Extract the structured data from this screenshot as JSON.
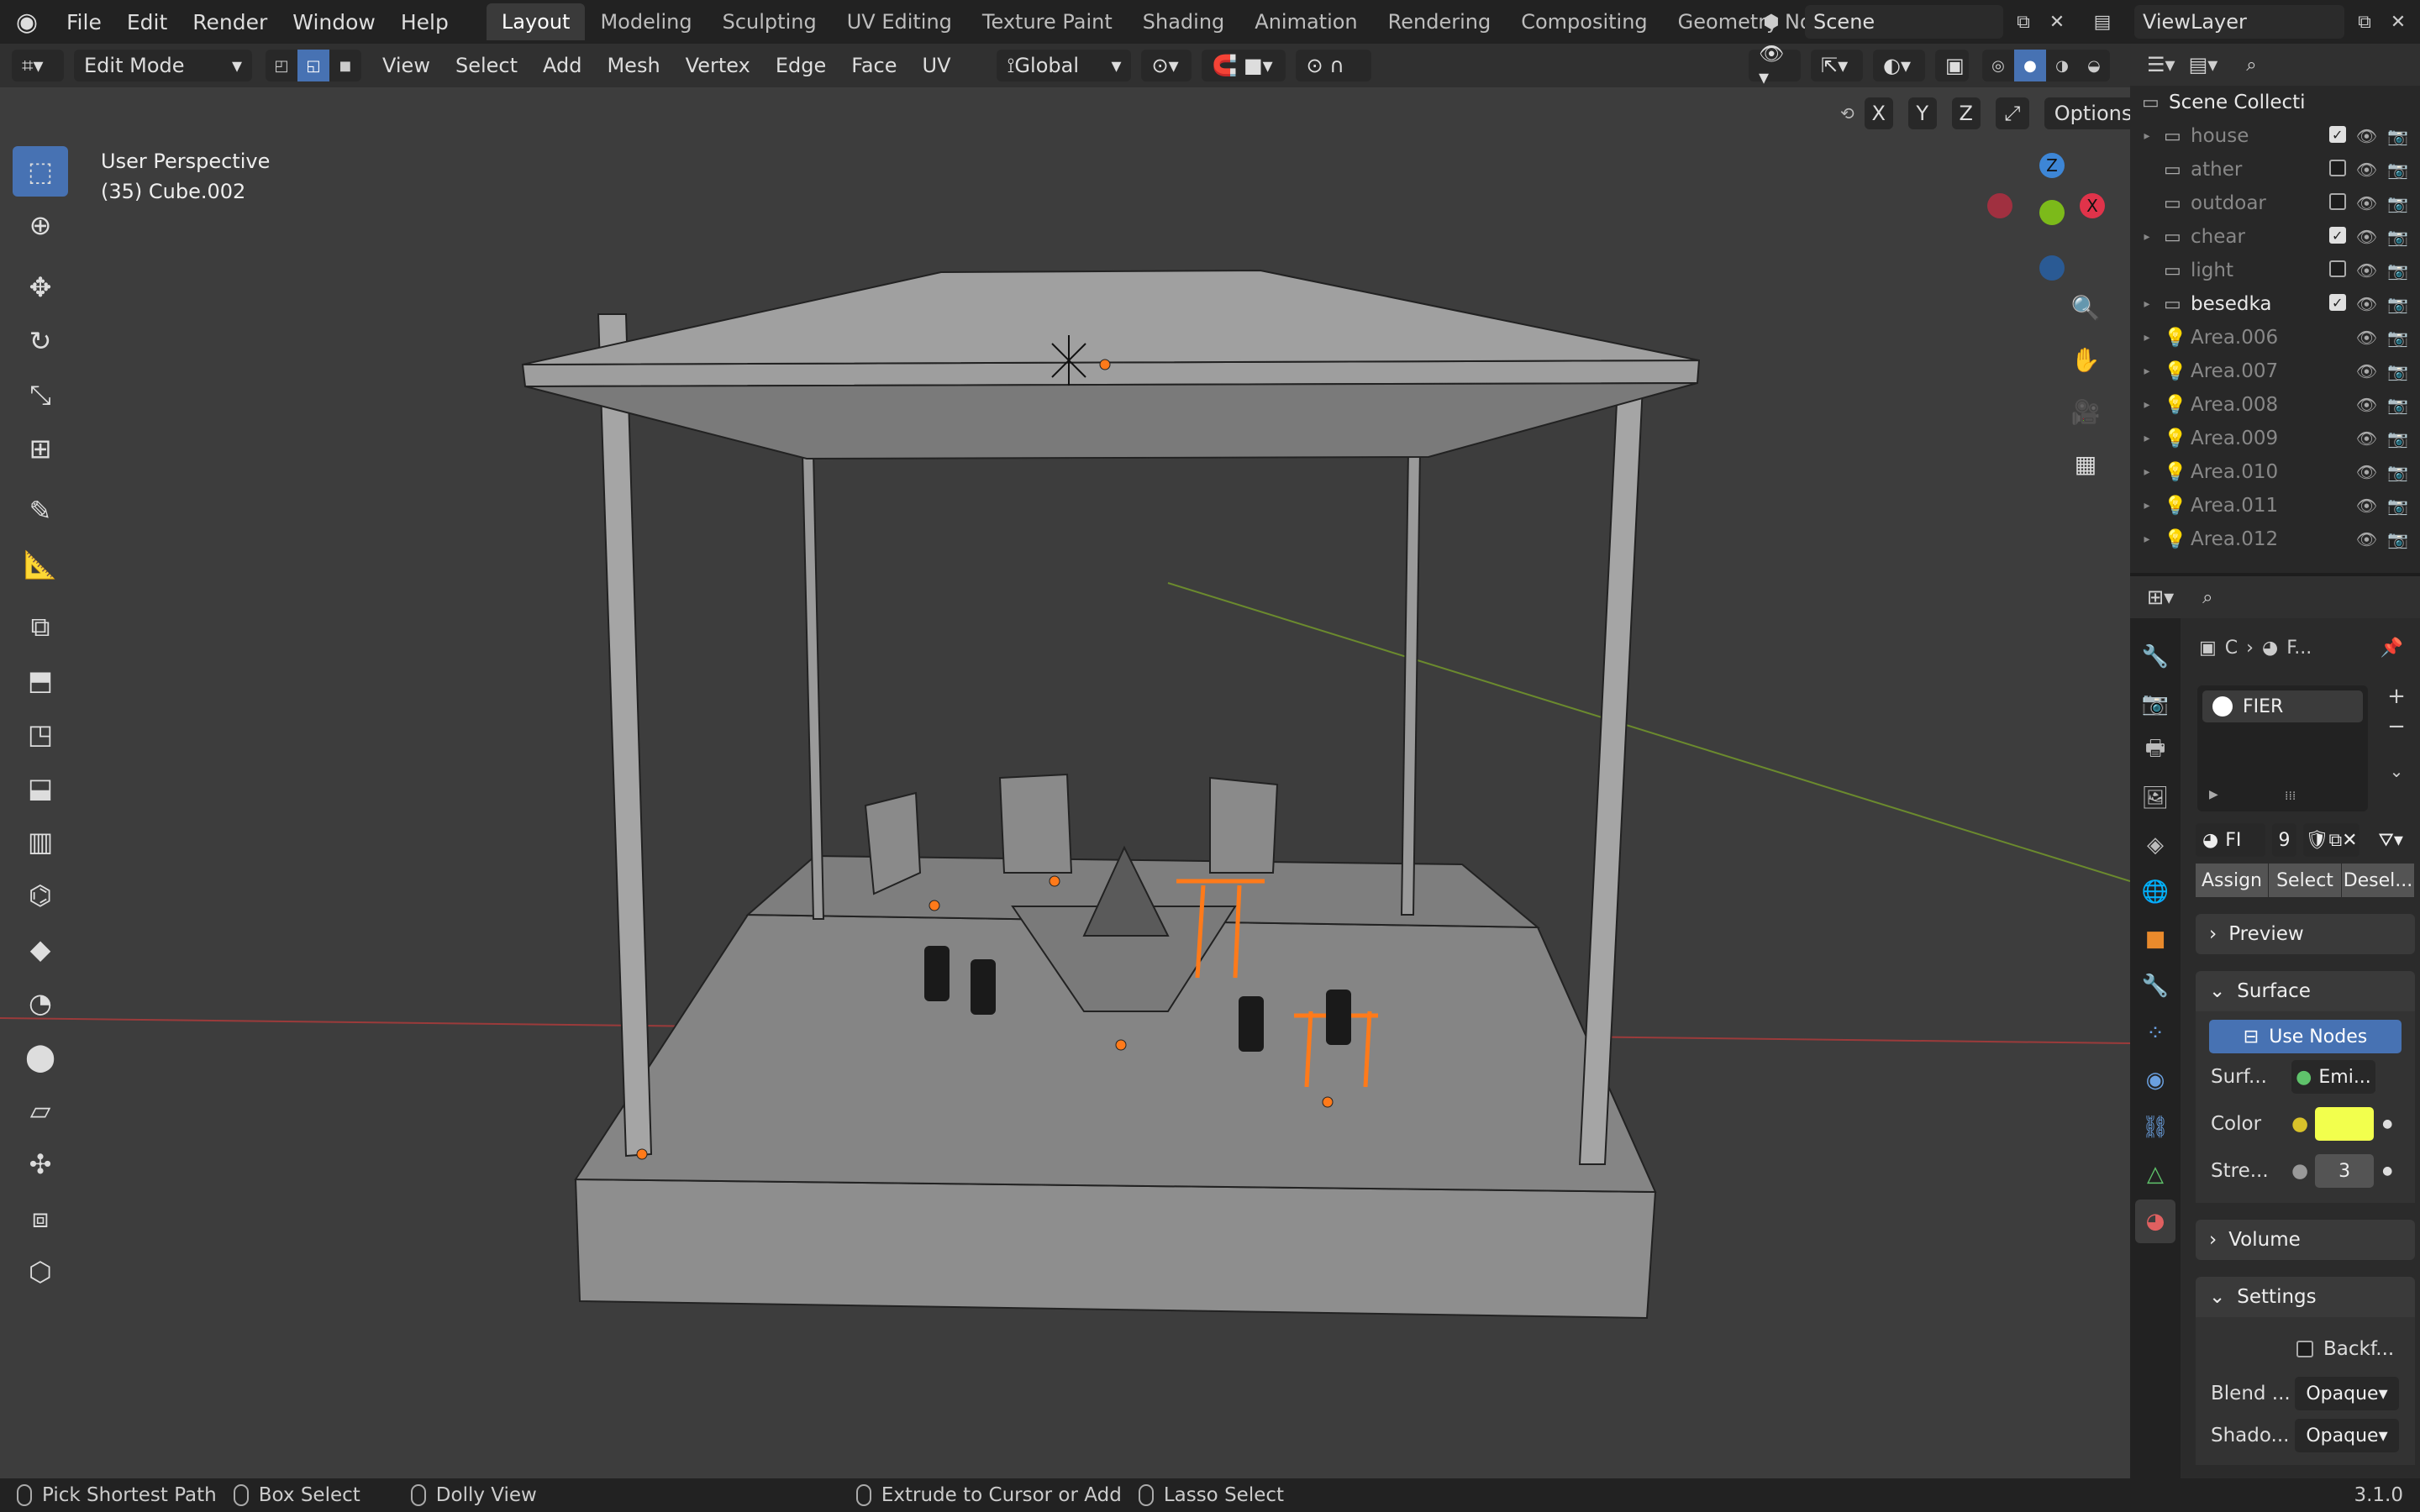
{
  "topbar": {
    "menus": [
      "File",
      "Edit",
      "Render",
      "Window",
      "Help"
    ],
    "workspaces": [
      "Layout",
      "Modeling",
      "Sculpting",
      "UV Editing",
      "Texture Paint",
      "Shading",
      "Animation",
      "Rendering",
      "Compositing",
      "Geometry Nodes"
    ],
    "active_workspace": "Layout",
    "scene_name": "Scene",
    "view_layer": "ViewLayer"
  },
  "viewport_header": {
    "mode": "Edit Mode",
    "menus": [
      "View",
      "Select",
      "Add",
      "Mesh",
      "Vertex",
      "Edge",
      "Face",
      "UV"
    ],
    "orientation": "Global",
    "axis_x": "X",
    "axis_y": "Y",
    "axis_z": "Z",
    "options": "Options"
  },
  "viewport": {
    "perspective": "User Perspective",
    "object_info": "(35) Cube.002",
    "gizmo_z": "Z",
    "gizmo_x": "X"
  },
  "outliner": {
    "root": "Scene Collecti",
    "items": [
      {
        "name": "house",
        "type": "collection",
        "checked": true,
        "expandable": true
      },
      {
        "name": "ather",
        "type": "collection",
        "checked": false,
        "expandable": false
      },
      {
        "name": "outdoar",
        "type": "collection",
        "checked": false,
        "expandable": false
      },
      {
        "name": "chear",
        "type": "collection",
        "checked": true,
        "expandable": true
      },
      {
        "name": "light",
        "type": "collection",
        "checked": false,
        "expandable": false
      },
      {
        "name": "besedka",
        "type": "collection",
        "checked": true,
        "expandable": true
      },
      {
        "name": "Area.006",
        "type": "light"
      },
      {
        "name": "Area.007",
        "type": "light"
      },
      {
        "name": "Area.008",
        "type": "light"
      },
      {
        "name": "Area.009",
        "type": "light"
      },
      {
        "name": "Area.010",
        "type": "light"
      },
      {
        "name": "Area.011",
        "type": "light"
      },
      {
        "name": "Area.012",
        "type": "light"
      }
    ]
  },
  "properties": {
    "breadcrumb_a": "C",
    "breadcrumb_b": "F...",
    "material_slot": "FIER",
    "material_name": "FI",
    "material_users": "9",
    "assign": "Assign",
    "select": "Select",
    "deselect": "Desel...",
    "preview": "Preview",
    "surface": "Surface",
    "use_nodes": "Use Nodes",
    "surf_label": "Surf...",
    "surf_value": "Emi...",
    "color_label": "Color",
    "color_value": "#f2ff4d",
    "strength_label": "Stre...",
    "strength_value": "3",
    "volume": "Volume",
    "settings": "Settings",
    "backface": "Backf...",
    "blend_label": "Blend ...",
    "blend_value": "Opaque",
    "shadow_label": "Shado...",
    "shadow_value": "Opaque"
  },
  "statusbar": {
    "left": "Pick Shortest Path",
    "box": "Box Select",
    "dolly": "Dolly View",
    "extrude": "Extrude to Cursor or Add",
    "lasso": "Lasso Select",
    "version": "3.1.0"
  },
  "colors": {
    "accent": "#4772b3",
    "selected_edge": "#ff7a1a",
    "axis_x": "#e0334a",
    "axis_y": "#7cba1a",
    "axis_z": "#3d86d6"
  }
}
